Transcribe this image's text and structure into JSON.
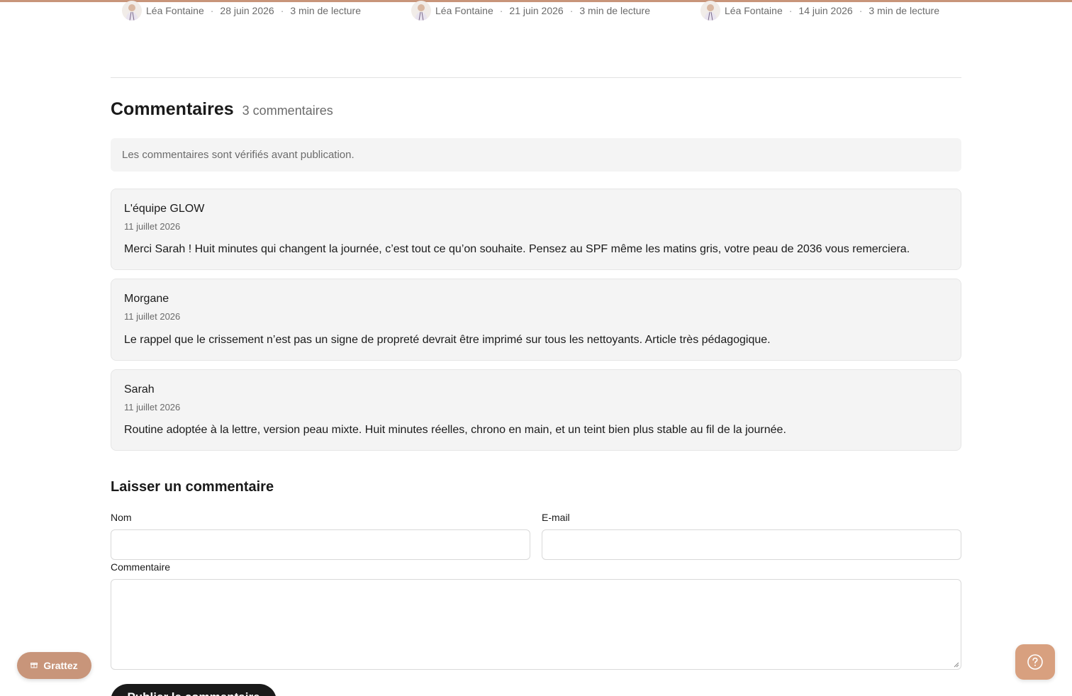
{
  "colors": {
    "accent": "#c8957a",
    "help_button": "#d8a07f",
    "dark_button": "#1a1a1a",
    "card_bg": "#f4f4f4",
    "muted_text": "#6b6b6b"
  },
  "related_posts": [
    {
      "author": "Léa Fontaine",
      "date": "28 juin 2026",
      "read_time": "3 min de lecture"
    },
    {
      "author": "Léa Fontaine",
      "date": "21 juin 2026",
      "read_time": "3 min de lecture"
    },
    {
      "author": "Léa Fontaine",
      "date": "14 juin 2026",
      "read_time": "3 min de lecture"
    }
  ],
  "comments_section": {
    "title": "Commentaires",
    "count_label": "3 commentaires",
    "notice": "Les commentaires sont vérifiés avant publication.",
    "comments": [
      {
        "author": "L'équipe GLOW",
        "date": "11 juillet 2026",
        "body": "Merci Sarah ! Huit minutes qui changent la journée, c’est tout ce qu’on souhaite. Pensez au SPF même les matins gris, votre peau de 2036 vous remerciera."
      },
      {
        "author": "Morgane",
        "date": "11 juillet 2026",
        "body": "Le rappel que le crissement n’est pas un signe de propreté devrait être imprimé sur tous les nettoyants. Article très pédagogique."
      },
      {
        "author": "Sarah",
        "date": "11 juillet 2026",
        "body": "Routine adoptée à la lettre, version peau mixte. Huit minutes réelles, chrono en main, et un teint bien plus stable au fil de la journée."
      }
    ]
  },
  "comment_form": {
    "title": "Laisser un commentaire",
    "name_label": "Nom",
    "name_value": "",
    "email_label": "E-mail",
    "email_value": "",
    "comment_label": "Commentaire",
    "comment_value": "",
    "submit_label": "Publier le commentaire"
  },
  "floating": {
    "grattez_label": "Grattez",
    "grattez_icon": "gift-icon",
    "help_icon": "question-circle-icon"
  }
}
